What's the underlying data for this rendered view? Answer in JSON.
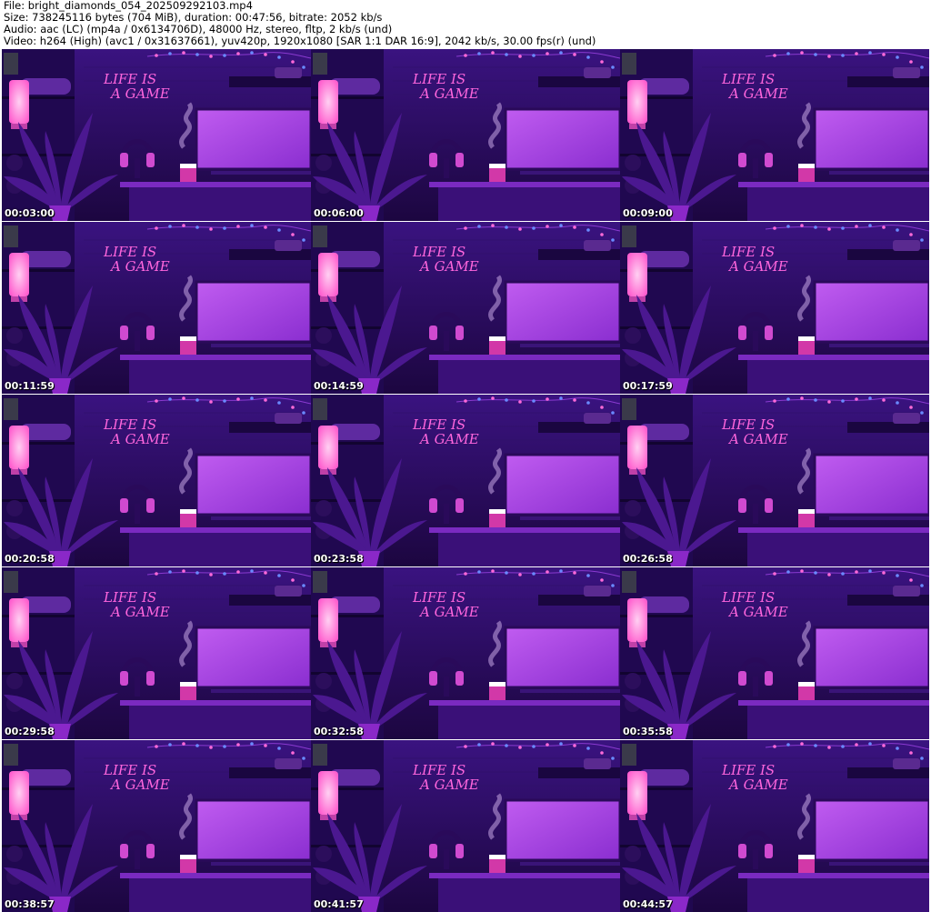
{
  "header": {
    "file_line": "File: bright_diamonds_054_202509292103.mp4",
    "size_line": "Size: 738245116 bytes (704 MiB), duration: 00:47:56, bitrate: 2052 kb/s",
    "audio_line": "Audio: aac (LC) (mp4a / 0x6134706D), 48000 Hz, stereo, fltp, 2 kb/s (und)",
    "video_line": "Video: h264 (High) (avc1 / 0x31637661), yuv420p, 1920x1080 [SAR 1:1 DAR 16:9], 2042 kb/s, 30.00 fps(r) (und)"
  },
  "scene": {
    "neon_line1": "LIFE IS",
    "neon_line2": "A GAME",
    "colors": {
      "background": "#3a0f78",
      "wall": "#2a0b5c",
      "neon": "#ff55d6",
      "monitor": "#b44ae6",
      "desk": "#6a22b0",
      "plant": "#4a148a",
      "lamp": "#ff8ad8"
    }
  },
  "thumbnails": [
    {
      "timestamp": "00:03:00"
    },
    {
      "timestamp": "00:06:00"
    },
    {
      "timestamp": "00:09:00"
    },
    {
      "timestamp": "00:11:59"
    },
    {
      "timestamp": "00:14:59"
    },
    {
      "timestamp": "00:17:59"
    },
    {
      "timestamp": "00:20:58"
    },
    {
      "timestamp": "00:23:58"
    },
    {
      "timestamp": "00:26:58"
    },
    {
      "timestamp": "00:29:58"
    },
    {
      "timestamp": "00:32:58"
    },
    {
      "timestamp": "00:35:58"
    },
    {
      "timestamp": "00:38:57"
    },
    {
      "timestamp": "00:41:57"
    },
    {
      "timestamp": "00:44:57"
    }
  ]
}
